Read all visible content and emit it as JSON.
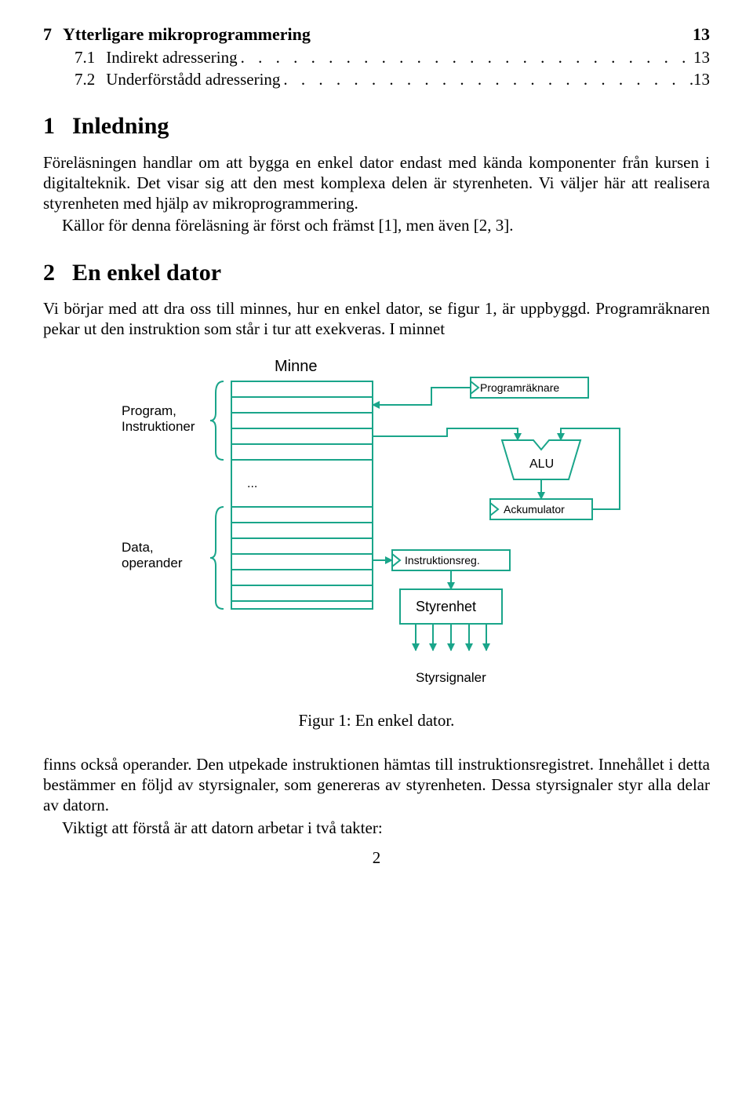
{
  "toc": {
    "section": {
      "num": "7",
      "title": "Ytterligare mikroprogrammering",
      "page": "13"
    },
    "subs": [
      {
        "num": "7.1",
        "title": "Indirekt adressering",
        "page": "13"
      },
      {
        "num": "7.2",
        "title": "Underförstådd adressering",
        "page": "13"
      }
    ]
  },
  "sections": {
    "s1": {
      "num": "1",
      "title": "Inledning"
    },
    "s2": {
      "num": "2",
      "title": "En enkel dator"
    }
  },
  "paragraphs": {
    "p1": "Föreläsningen handlar om att bygga en enkel dator endast med kända komponenter från kursen i digitalteknik. Det visar sig att den mest komplexa delen är styrenheten. Vi väljer här att realisera styrenheten med hjälp av mikroprogrammering.",
    "p1b": "Källor för denna föreläsning är först och främst [1], men även [2, 3].",
    "p2": "Vi börjar med att dra oss till minnes, hur en enkel dator, se figur 1, är uppbyggd. Programräknaren pekar ut den instruktion som står i tur att exekveras. I minnet",
    "p3": "finns också operander. Den utpekade instruktionen hämtas till instruktionsregistret. Innehållet i detta bestämmer en följd av styrsignaler, som genereras av styrenheten. Dessa styrsignaler styr alla delar av datorn.",
    "p4": "Viktigt att förstå är att datorn arbetar i två takter:"
  },
  "figure": {
    "caption": "Figur 1: En enkel dator.",
    "labels": {
      "minne": "Minne",
      "program": "Program,",
      "instruktioner": "Instruktioner",
      "dots": "...",
      "data": "Data,",
      "operander": "operander",
      "programraknare": "Programräknare",
      "alu": "ALU",
      "ackumulator": "Ackumulator",
      "instruktionsreg": "Instruktionsreg.",
      "styrenhet": "Styrenhet",
      "styrsignaler": "Styrsignaler"
    }
  },
  "pageNumber": "2",
  "dots": ". . . . . . . . . . . . . . . . . . . . . . . . . . . . . . . . . . . . . . . . . . . ."
}
